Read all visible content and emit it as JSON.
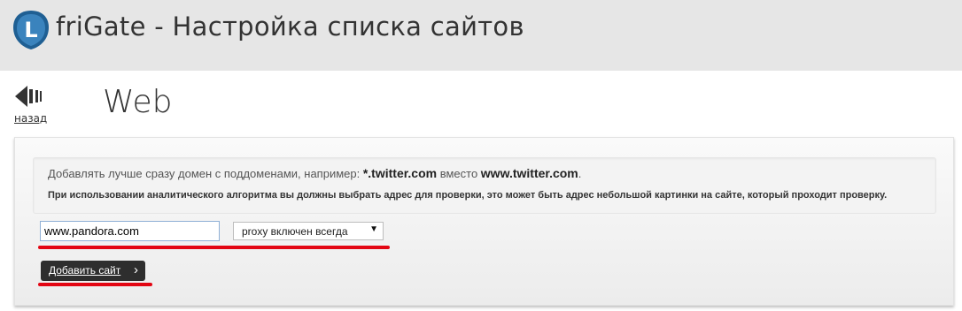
{
  "header": {
    "logo_letter": "L",
    "title": "friGate - Настройка списка сайтов"
  },
  "nav": {
    "back_icon": "back-arrow-icon",
    "back_label": "назад"
  },
  "page": {
    "title": "Web"
  },
  "hints": {
    "line1_prefix": "Добавлять лучше сразу домен с поддоменами, например: ",
    "line1_example1": "*.twitter.com",
    "line1_middle": " вместо ",
    "line1_example2": "www.twitter.com",
    "line1_suffix": ".",
    "line2": "При использовании аналитического алгоритма вы должны выбрать адрес для проверки, это может быть адрес небольшой картинки на сайте, который проходит проверку."
  },
  "form": {
    "site_value": "www.pandora.com",
    "mode_selected": "proxy включен всегда",
    "add_button_label": "Добавить сайт",
    "add_button_icon": "chevron-right-icon"
  },
  "colors": {
    "header_bg": "#e6e6e6",
    "logo_blue": "#1f5f93",
    "annotation_red": "#e30613",
    "button_dark": "#2e2e2e"
  }
}
